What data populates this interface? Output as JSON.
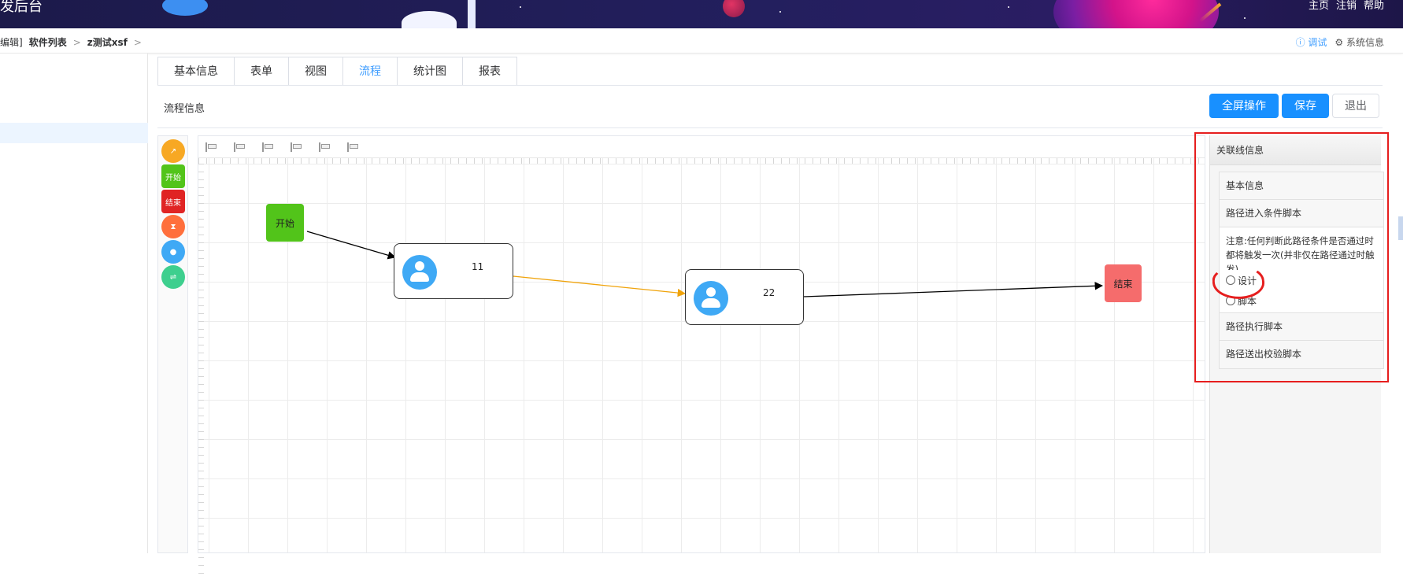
{
  "header": {
    "title": "发后台",
    "nav": [
      "主页",
      "注销",
      "帮助"
    ]
  },
  "breadcrumb": {
    "items": [
      "编辑]",
      "软件列表",
      "z测试xsf"
    ],
    "separator": ">",
    "actions": {
      "debug": "调试",
      "system": "系统信息"
    }
  },
  "tabs": [
    {
      "label": "基本信息",
      "active": false
    },
    {
      "label": "表单",
      "active": false
    },
    {
      "label": "视图",
      "active": false
    },
    {
      "label": "流程",
      "active": true
    },
    {
      "label": "统计图",
      "active": false
    },
    {
      "label": "报表",
      "active": false
    }
  ],
  "section": {
    "title": "流程信息",
    "buttons": {
      "fullscreen": "全屏操作",
      "save": "保存",
      "exit": "退出"
    }
  },
  "palette": [
    {
      "name": "connector-tool",
      "label": "",
      "color": "#f7a823"
    },
    {
      "name": "start-node-tool",
      "label": "开始",
      "color": "#52c41a"
    },
    {
      "name": "end-node-tool",
      "label": "结束",
      "color": "#e02424"
    },
    {
      "name": "timer-node-tool",
      "label": "",
      "color": "#ff6f3c"
    },
    {
      "name": "user-task-tool",
      "label": "",
      "color": "#3fa9f5"
    },
    {
      "name": "switch-node-tool",
      "label": "",
      "color": "#3ecf8e"
    }
  ],
  "canvas": {
    "nodes": {
      "start": "开始",
      "task1": "11",
      "task2": "22",
      "end": "结束"
    },
    "edge_colors": {
      "normal": "#000000",
      "selected": "#f0a30a"
    }
  },
  "panel": {
    "header": "关联线信息",
    "items": {
      "basic": "基本信息",
      "entry_script": "路径进入条件脚本",
      "note": "注意:任何判断此路径条件是否通过时都将触发一次(并非仅在路径通过时触发)",
      "options": [
        "设计",
        "脚本"
      ],
      "exec_script": "路径执行脚本",
      "exit_script": "路径送出校验脚本"
    }
  },
  "colors": {
    "accent": "#409eff",
    "primary_button": "#1890ff",
    "annotation": "#e61e1e"
  }
}
